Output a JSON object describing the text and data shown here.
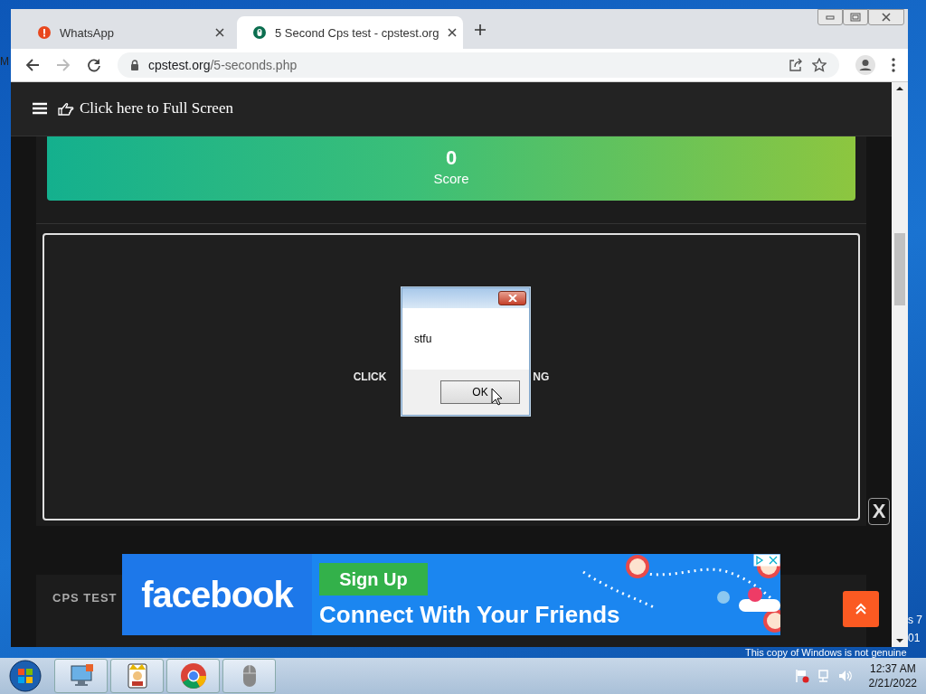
{
  "desktop": {
    "edge_texts": [
      {
        "text": "M",
        "kind": "left"
      },
      {
        "text": "s 7",
        "kind": "right"
      },
      {
        "text": "01",
        "kind": "right"
      }
    ],
    "notice": "This copy of Windows is not genuine"
  },
  "browser": {
    "tabs": [
      {
        "title": "WhatsApp",
        "selected": false,
        "kind": "alert"
      },
      {
        "title": "5 Second Cps test - cpstest.org",
        "selected": true,
        "kind": "site"
      }
    ],
    "address": {
      "host": "cpstest.org",
      "path": "/5-seconds.php"
    }
  },
  "page": {
    "header": {
      "label": "Click here to Full Screen"
    },
    "score": {
      "value": "0",
      "label": "Score"
    },
    "click_area": {
      "text_left": "CLICK",
      "text_right": "NG"
    },
    "close_label": "X",
    "footer_label": "CPS TEST",
    "ad": {
      "brand": "facebook",
      "button": "Sign Up",
      "tagline": "Connect With Your Friends"
    }
  },
  "dialog": {
    "message": "stfu",
    "button": "OK"
  },
  "taskbar": {
    "items": [
      {
        "kind": "monitor"
      },
      {
        "kind": "cards"
      },
      {
        "kind": "chrome"
      },
      {
        "kind": "mouse"
      }
    ],
    "time": "12:37 AM",
    "date": "2/21/2022"
  }
}
